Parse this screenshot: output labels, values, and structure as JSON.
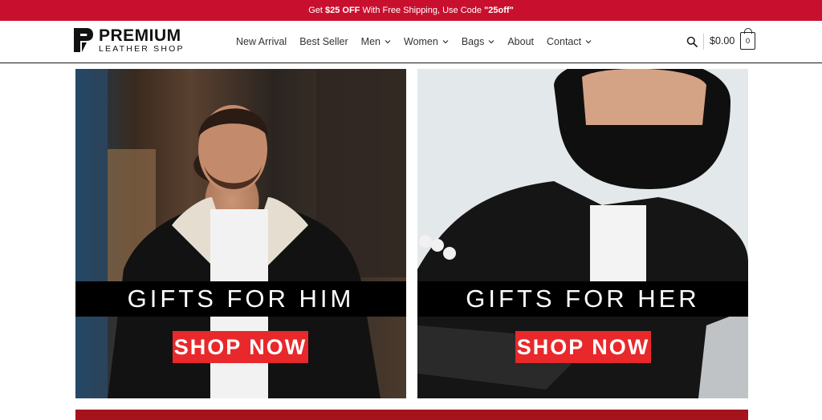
{
  "promo": {
    "pre": "Get ",
    "amount": "$25 OFF",
    "mid": " With Free Shipping, Use Code ",
    "code": "\"25off\""
  },
  "logo": {
    "line1": "PREMIUM",
    "line2": "LEATHER SHOP"
  },
  "nav": {
    "items": [
      {
        "label": "New Arrival",
        "dropdown": false
      },
      {
        "label": "Best Seller",
        "dropdown": false
      },
      {
        "label": "Men",
        "dropdown": true
      },
      {
        "label": "Women",
        "dropdown": true
      },
      {
        "label": "Bags",
        "dropdown": true
      },
      {
        "label": "About",
        "dropdown": false
      },
      {
        "label": "Contact",
        "dropdown": true
      }
    ]
  },
  "cart": {
    "total": "$0.00",
    "count": "0"
  },
  "banners": {
    "him": {
      "title": "GIFTS FOR HIM",
      "button": "SHOP NOW"
    },
    "her": {
      "title": "GIFTS FOR HER",
      "button": "SHOP NOW"
    }
  },
  "colors": {
    "brand_red": "#c8102e",
    "button_red": "#e8282b"
  }
}
